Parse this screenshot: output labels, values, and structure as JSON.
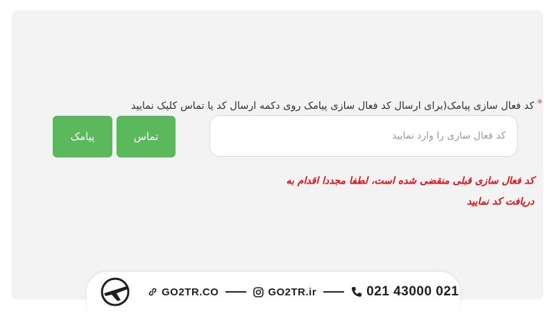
{
  "form": {
    "required_mark": "*",
    "label": "کد فعال سازی پیامک(برای ارسال کد فعال سازی پیامک روی دکمه ارسال کد یا تماس کلیک نمایید",
    "input_value": "",
    "input_placeholder": "کد فعال سازی را وارد نمایید",
    "call_button": "تماس",
    "sms_button": "پیامک",
    "error_line1": "کد فعال سازی قبلی منقضی شده است، لطفا مجددا اقدام به",
    "error_line2": "دریافت کد نمایید"
  },
  "footer": {
    "website": "GO2TR.CO",
    "instagram": "GO2TR.ir",
    "phone": "021 43000 021"
  },
  "colors": {
    "accent_green": "#5cb85c",
    "error_red": "#e0101a",
    "required_red": "#d9534f"
  },
  "icons": [
    "airplane-logo-icon",
    "link-icon",
    "instagram-icon",
    "phone-icon"
  ]
}
